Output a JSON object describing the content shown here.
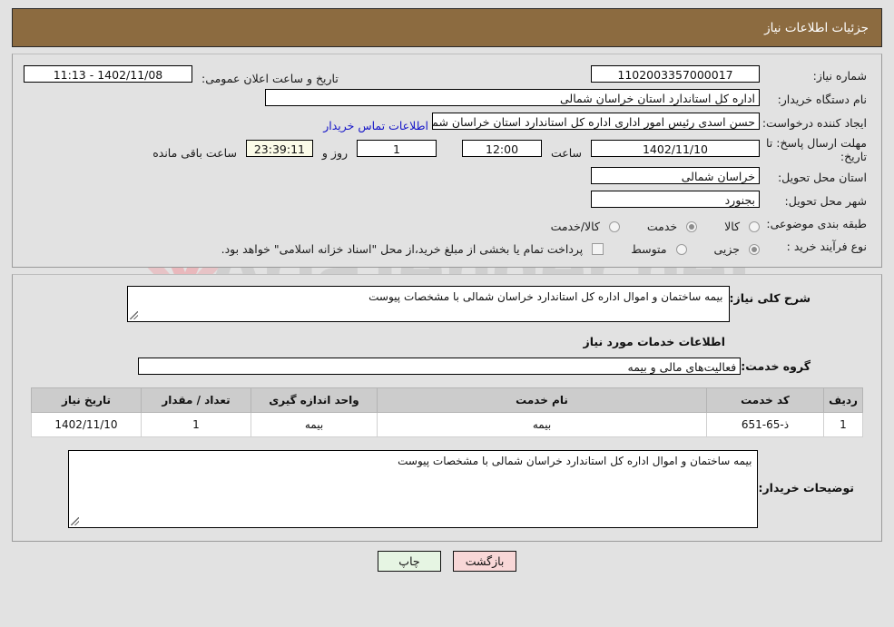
{
  "header": {
    "title": "جزئیات اطلاعات نیاز"
  },
  "watermark": {
    "text": "AriaTender.net",
    "logo_letter": "V",
    "shield_color": "#e9b8bc",
    "text_color": "#cfcfcf"
  },
  "form": {
    "need_number_label": "شماره نیاز:",
    "need_number_value": "1102003357000017",
    "announce_label": "تاریخ و ساعت اعلان عمومی:",
    "announce_value": "1402/11/08 - 11:13",
    "buyer_org_label": "نام دستگاه خریدار:",
    "buyer_org_value": "اداره کل استاندارد استان خراسان شمالی",
    "creator_label": "ایجاد کننده درخواست:",
    "creator_value": "حسن اسدی رئیس امور اداری اداره کل استاندارد استان خراسان شمالی",
    "contact_link": "اطلاعات تماس خریدار",
    "deadline_label": "مهلت ارسال پاسخ: تا تاریخ:",
    "deadline_date": "1402/11/10",
    "hour_label": "ساعت",
    "hour_value": "12:00",
    "days_value": "1",
    "days_label": "روز و",
    "remaining_value": "23:39:11",
    "remaining_label": "ساعت باقی مانده",
    "province_label": "استان محل تحویل:",
    "province_value": "خراسان شمالی",
    "city_label": "شهر محل تحویل:",
    "city_value": "بجنورد",
    "category_label": "طبقه بندی موضوعی:",
    "category_options": [
      {
        "label": "کالا",
        "selected": false
      },
      {
        "label": "خدمت",
        "selected": true
      },
      {
        "label": "کالا/خدمت",
        "selected": false
      }
    ],
    "process_label": "نوع فرآیند خرید :",
    "process_options": [
      {
        "label": "جزیی",
        "selected": true
      },
      {
        "label": "متوسط",
        "selected": false
      }
    ],
    "treasury_checkbox_checked": false,
    "treasury_text": "پرداخت تمام یا بخشی از مبلغ خرید،از محل \"اسناد خزانه اسلامی\" خواهد بود."
  },
  "details": {
    "summary_label": "شرح کلی نیاز:",
    "summary_value": "بیمه ساختمان و اموال اداره کل استاندارد خراسان شمالی با مشخصات پیوست",
    "services_heading": "اطلاعات خدمات مورد نیاز",
    "service_group_label": "گروه خدمت:",
    "service_group_value": "فعالیت‌های مالی و بیمه",
    "comments_label": "توضیحات خریدار:",
    "comments_value": "بیمه ساختمان و اموال اداره کل استاندارد خراسان شمالی با مشخصات پیوست"
  },
  "table": {
    "columns": [
      "ردیف",
      "کد خدمت",
      "نام خدمت",
      "واحد اندازه گیری",
      "تعداد / مقدار",
      "تاریخ نیاز"
    ],
    "rows": [
      {
        "radif": "1",
        "code": "ذ-65-651",
        "name": "بیمه",
        "unit": "بیمه",
        "qty": "1",
        "date": "1402/11/10"
      }
    ]
  },
  "footer": {
    "print_label": "چاپ",
    "back_label": "بازگشت"
  }
}
